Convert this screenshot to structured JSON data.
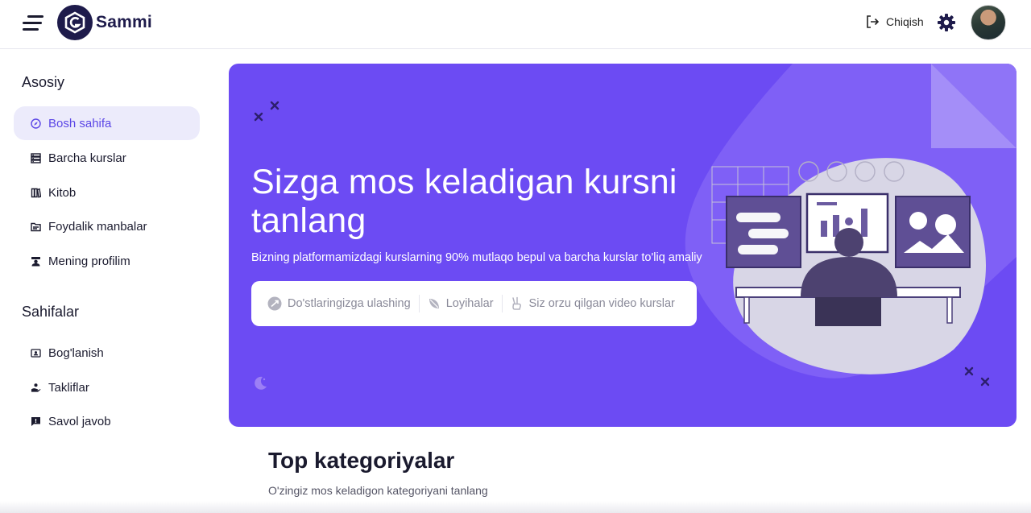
{
  "header": {
    "logo_text": "Sammi",
    "logout_label": "Chiqish"
  },
  "sidebar": {
    "section_main": "Asosiy",
    "main_items": [
      {
        "label": "Bosh sahifa",
        "icon": "compass-icon",
        "active": true
      },
      {
        "label": "Barcha kurslar",
        "icon": "list-icon"
      },
      {
        "label": "Kitob",
        "icon": "book-icon"
      },
      {
        "label": "Foydalik manbalar",
        "icon": "folder-icon"
      },
      {
        "label": "Mening profilim",
        "icon": "profile-icon"
      }
    ],
    "section_pages": "Sahifalar",
    "page_items": [
      {
        "label": "Bog'lanish",
        "icon": "contact-card-icon"
      },
      {
        "label": "Takliflar",
        "icon": "hand-offer-icon"
      },
      {
        "label": "Savol javob",
        "icon": "question-chat-icon"
      }
    ]
  },
  "hero": {
    "title": "Sizga mos keladigan kursni tanlang",
    "subtitle": "Bizning platformamizdagi kurslarning 90% mutlaqo bepul va barcha kurslar to'liq amaliy",
    "pill_items": [
      {
        "label": "Do'stlaringizga ulashing",
        "icon": "share-icon"
      },
      {
        "label": "Loyihalar",
        "icon": "leaf-icon"
      },
      {
        "label": "Siz orzu qilgan video kurslar",
        "icon": "peace-hand-icon"
      }
    ]
  },
  "categories": {
    "title": "Top kategoriyalar",
    "subtitle": "O'zingiz mos keladigon kategoriyani tanlang"
  },
  "colors": {
    "accent": "#6c4bf3",
    "brand_dark": "#1e1b4b",
    "active_bg": "#ecebfb",
    "active_text": "#5b46e6"
  }
}
